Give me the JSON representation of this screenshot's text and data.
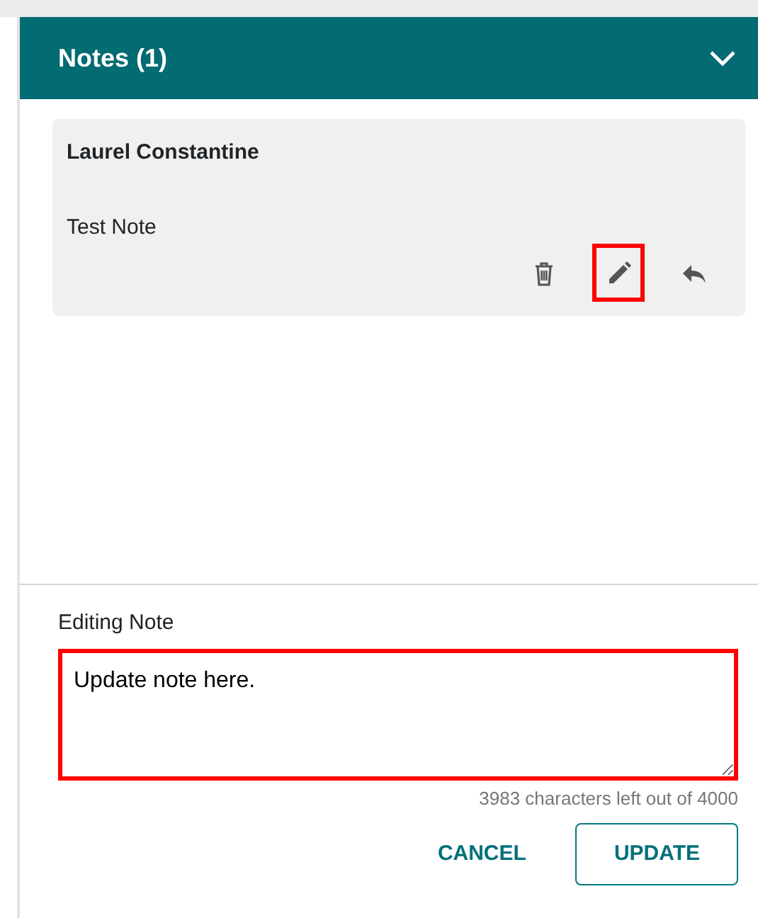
{
  "panel": {
    "title": "Notes (1)",
    "expanded": true
  },
  "notes": [
    {
      "author": "Laurel Constantine",
      "text": "Test Note",
      "actions": [
        {
          "kind": "delete",
          "highlighted": false
        },
        {
          "kind": "edit",
          "highlighted": true
        },
        {
          "kind": "reply",
          "highlighted": false
        }
      ]
    }
  ],
  "editor": {
    "label": "Editing Note",
    "value": "Update note here.",
    "highlighted": true,
    "counter": "3983 characters left out of 4000"
  },
  "buttons": [
    {
      "label": "CANCEL",
      "kind": "text"
    },
    {
      "label": "UPDATE",
      "kind": "outlined"
    }
  ]
}
